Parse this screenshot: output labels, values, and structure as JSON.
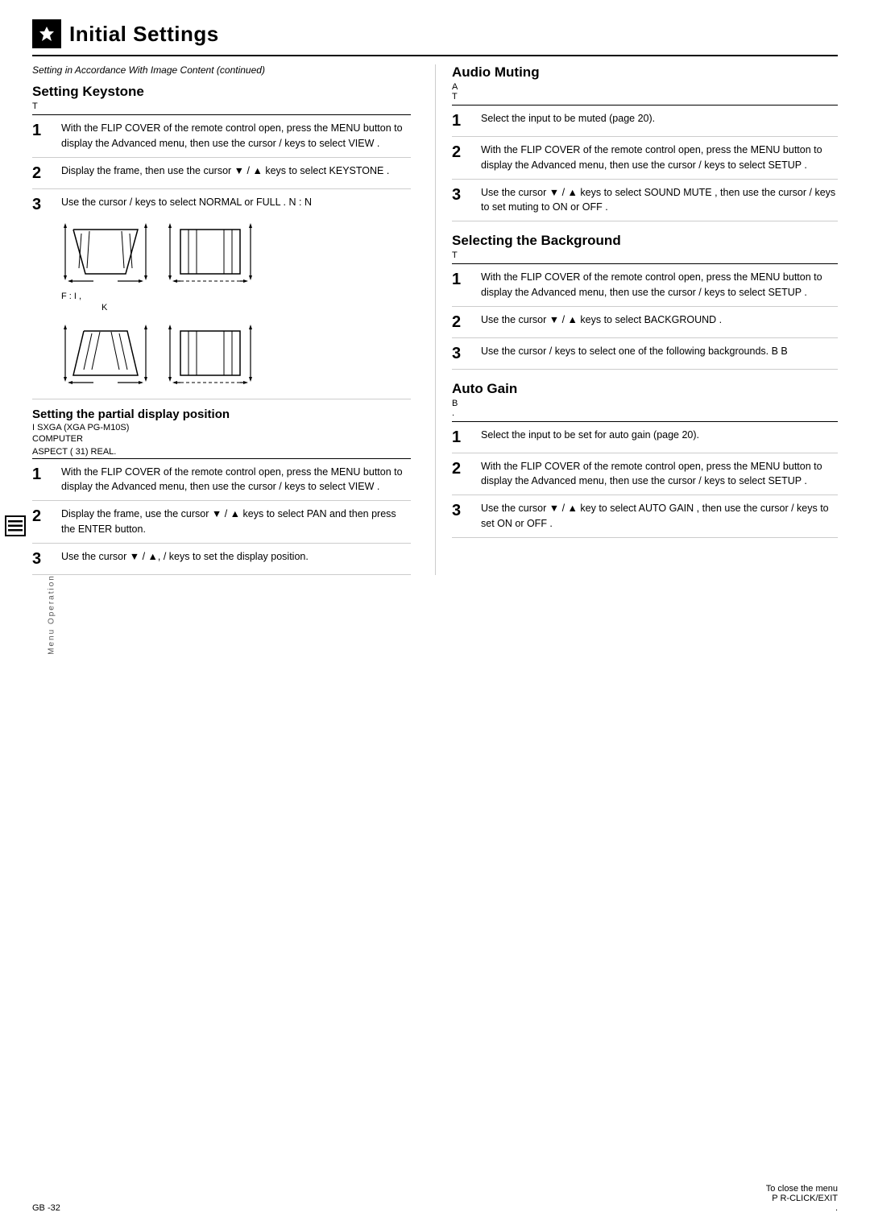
{
  "header": {
    "title": "Initial Settings",
    "icon_label": "settings-icon"
  },
  "page_subtitle": "Setting in Accordance With Image Content (continued)",
  "left": {
    "keystone": {
      "title": "Setting Keystone",
      "sub": "T",
      "steps": [
        {
          "num": "1",
          "text": "With the FLIP COVER of the remote control open, press the MENU button to display the Advanced menu, then use the cursor      /      keys to select    VIEW  ."
        },
        {
          "num": "2",
          "text": "Display the frame, then use the cursor\n▼ / ▲ keys to select    KEYSTONE  ."
        },
        {
          "num": "3",
          "text": "Use the cursor    /    keys to select\nNORMAL  or  FULL  .\nN      : N"
        }
      ],
      "diagram_caption": "F  : I          ,",
      "diagram_caption2": "K"
    },
    "partial": {
      "title": "Setting the partial display position",
      "sub1": "I                   SXGA (XGA              PG-M10S)",
      "sub2": "COMPUTER",
      "sub3": "ASPECT (          31)      REAL.",
      "steps": [
        {
          "num": "1",
          "text": "With the FLIP COVER of the remote control open, press the MENU button to display the Advanced menu, then use the cursor      /      keys to select    VIEW  ."
        },
        {
          "num": "2",
          "text": "Display the frame, use the cursor    ▼ / ▲\nkeys to select    PAN   and then press the\nENTER button."
        },
        {
          "num": "3",
          "text": "Use the cursor  ▼ / ▲,   /    keys to set the\ndisplay position."
        }
      ]
    }
  },
  "right": {
    "audio_muting": {
      "title": "Audio Muting",
      "sub1": "A",
      "sub2": "T",
      "sub3": ".",
      "steps": [
        {
          "num": "1",
          "text": "Select the input to be muted (page 20)."
        },
        {
          "num": "2",
          "text": "With the FLIP COVER of the remote control open, press the MENU button to display the Advanced menu, then use the cursor      /      keys to select    SETUP  ."
        },
        {
          "num": "3",
          "text": "Use the cursor  ▼ / ▲  keys to select\n  SOUND MUTE  , then use the cursor     /\nkeys to set muting to    ON  or  OFF  ."
        }
      ]
    },
    "background": {
      "title": "Selecting the Background",
      "sub": "T",
      "steps": [
        {
          "num": "1",
          "text": "With the FLIP COVER of the remote control open, press the MENU button to display the Advanced menu, then use the cursor      /      keys to select    SETUP  ."
        },
        {
          "num": "2",
          "text": "Use the cursor  ▼ / ▲  keys to select\n  BACKGROUND  ."
        },
        {
          "num": "3",
          "text": "Use the cursor    /    keys to select one of\nthe following backgrounds.\nB             B"
        }
      ]
    },
    "auto_gain": {
      "title": "Auto Gain",
      "sub": "B",
      "sub2": ".",
      "steps": [
        {
          "num": "1",
          "text": "Select the input to be set for auto gain (page\n20)."
        },
        {
          "num": "2",
          "text": "With the FLIP COVER of the remote control open, press the MENU button to display the Advanced menu, then use the cursor      /      keys to select    SETUP  ."
        },
        {
          "num": "3",
          "text": "Use the cursor  ▼ / ▲  key to select    AUTO\nGAIN  , then use the cursor      /     keys to\nset  ON  or  OFF  ."
        }
      ]
    }
  },
  "footer": {
    "left": "GB -32",
    "right_line1": "To close the menu",
    "right_line2": "P       R-CLICK/EXIT",
    "right_line3": "."
  },
  "side_tab": "Menu Operation"
}
